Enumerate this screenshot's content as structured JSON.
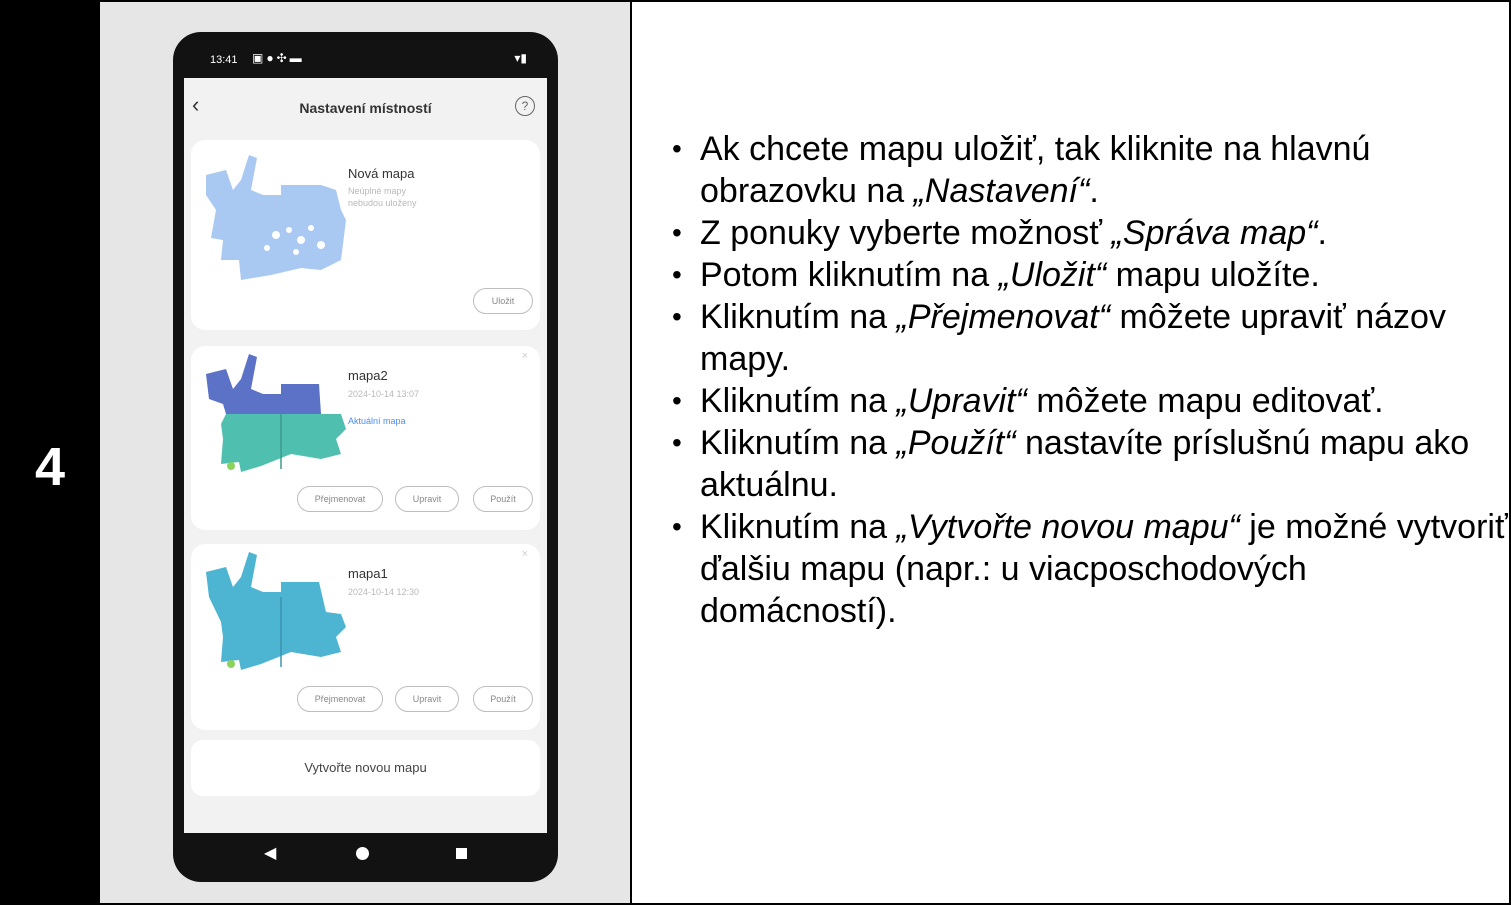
{
  "step": "4",
  "phone": {
    "status_time": "13:41",
    "app_title": "Nastavení místností",
    "cards": [
      {
        "name": "Nová mapa",
        "subtitle_line1": "Neúplné mapy",
        "subtitle_line2": "nebudou uloženy",
        "buttons": [
          "Uložit"
        ]
      },
      {
        "name": "mapa2",
        "date": "2024-10-14 13:07",
        "active_label": "Aktuální mapa",
        "buttons": [
          "Přejmenovat",
          "Upravit",
          "Použít"
        ]
      },
      {
        "name": "mapa1",
        "date": "2024-10-14 12:30",
        "buttons": [
          "Přejmenovat",
          "Upravit",
          "Použít"
        ]
      }
    ],
    "new_map_label": "Vytvořte novou mapu",
    "map_colors": {
      "new": "#a9c8f2",
      "map2_top": "#5b72c6",
      "map2_bottom": "#4fbfb0",
      "map1": "#4db4d2"
    }
  },
  "instructions": [
    {
      "pre": "Ak chcete mapu uložiť, tak kliknite na hlavnú obrazovku na ",
      "em": "„Nastavení“",
      "post": "."
    },
    {
      "pre": "Z ponuky vyberte možnosť ",
      "em": "„Správa map“",
      "post": "."
    },
    {
      "pre": "Potom kliknutím na ",
      "em": "„Uložit“",
      "post": " mapu uložíte."
    },
    {
      "pre": "Kliknutím na ",
      "em": "„Přejmenovat“",
      "post": " môžete upraviť názov mapy."
    },
    {
      "pre": "Kliknutím na ",
      "em": "„Upravit“",
      "post": " môžete mapu editovať."
    },
    {
      "pre": "Kliknutím na ",
      "em": "„Použít“",
      "post": " nastavíte príslušnú mapu ako aktuálnu."
    },
    {
      "pre": "Kliknutím na ",
      "em": "„Vytvořte novou mapu“",
      "post": " je možné vytvoriť ďalšiu mapu (napr.: u viacposchodových domácností)."
    }
  ]
}
